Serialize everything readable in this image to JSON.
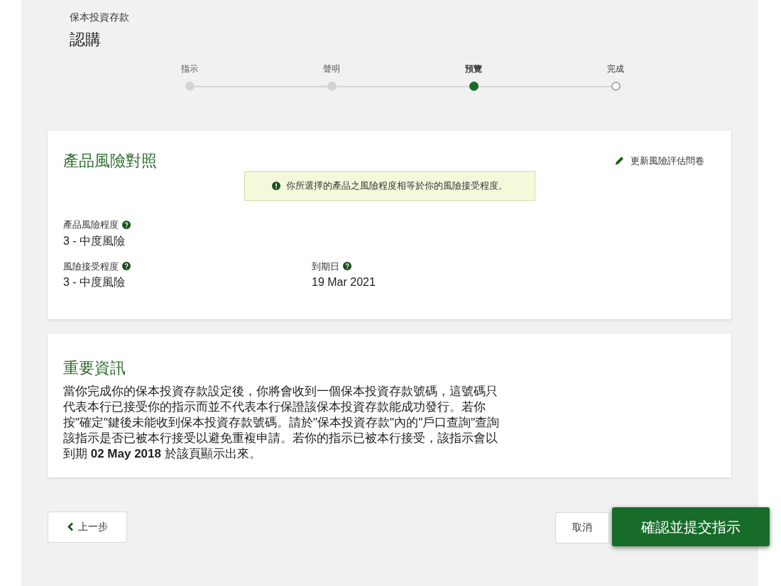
{
  "header": {
    "product": "保本投資存款",
    "title": "認購"
  },
  "steps": [
    {
      "label": "指示",
      "completed": true,
      "selected": false
    },
    {
      "label": "聲明",
      "completed": true,
      "selected": false
    },
    {
      "label": "預覽",
      "completed": false,
      "selected": true
    },
    {
      "label": "完成",
      "completed": false,
      "selected": false
    }
  ],
  "risk_card": {
    "title": "產品風險對照",
    "update_link": "更新風險評估問卷",
    "notice": "你所選擇的產品之風險程度相等於你的風險接受程度。",
    "fields": [
      {
        "label": "產品風險程度",
        "value": "3 - 中度風險"
      },
      {
        "label": "風險接受程度",
        "value": "3 - 中度風險"
      },
      {
        "label": "到期日",
        "value": "19 Mar 2021"
      }
    ]
  },
  "info_card": {
    "title": "重要資訊",
    "text": "當你完成你的保本投資存款設定後，你將會收到一個保本投資存款號碼，這號碼只代表本行已接受你的指示而並不代表本行保證該保本投資存款能成功發行。若你按\"確定\"鍵後未能收到保本投資存款號碼。請於\"保本投資存款\"內的\"戶口查詢\"查詢該指示是否已被本行接受以避免重複申請。若你的指示已被本行接受，該指示會以到期 **02 May 2018** 於該頁顯示出來。"
  },
  "buttons": {
    "back": "上一步",
    "cancel": "取消",
    "submit": "確認並提交指示"
  }
}
